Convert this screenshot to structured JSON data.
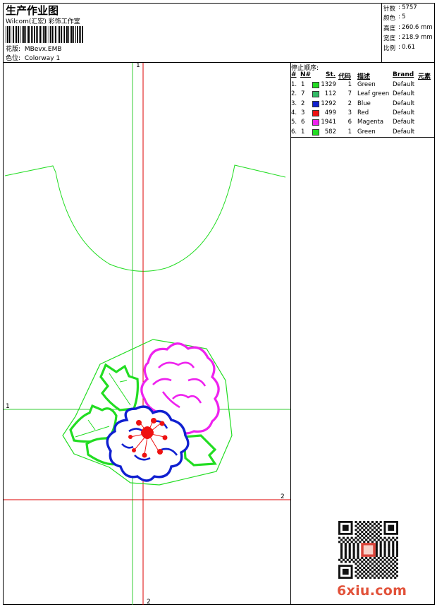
{
  "header": {
    "title": "生产作业图",
    "subtitle": "Wilcom(汇宏) 彩饰工作室",
    "design_label": "花版:",
    "design_value": "MBevx.EMB",
    "colorway_label": "色位:",
    "colorway_value": "Colorway 1"
  },
  "stats": [
    {
      "label": "针数",
      "value": "5757"
    },
    {
      "label": "颜色",
      "value": "5"
    },
    {
      "label": "高度",
      "value": "260.6 mm"
    },
    {
      "label": "宽度",
      "value": "218.9 mm"
    },
    {
      "label": "比例",
      "value": "0.61"
    }
  ],
  "sequence": {
    "title": "停止顺序:",
    "headers": {
      "index": "#",
      "no": "N#",
      "st": "St.",
      "code": "代码",
      "desc": "描述",
      "brand": "Brand",
      "elem": "元素"
    },
    "rows": [
      {
        "index": "1.",
        "no": "1",
        "color": "#22dd22",
        "st": "1329",
        "code": "1",
        "desc": "Green",
        "brand": "Default"
      },
      {
        "index": "2.",
        "no": "7",
        "color": "#33bb66",
        "st": "112",
        "code": "7",
        "desc": "Leaf green",
        "brand": "Default"
      },
      {
        "index": "3.",
        "no": "2",
        "color": "#1020d0",
        "st": "1292",
        "code": "2",
        "desc": "Blue",
        "brand": "Default"
      },
      {
        "index": "4.",
        "no": "3",
        "color": "#ee1111",
        "st": "499",
        "code": "3",
        "desc": "Red",
        "brand": "Default"
      },
      {
        "index": "5.",
        "no": "6",
        "color": "#ee22ee",
        "st": "1941",
        "code": "6",
        "desc": "Magenta",
        "brand": "Default"
      },
      {
        "index": "6.",
        "no": "1",
        "color": "#22dd22",
        "st": "582",
        "code": "1",
        "desc": "Green",
        "brand": "Default"
      }
    ]
  },
  "guides": {
    "v_green_label": "1",
    "h_green_label": "1",
    "h_red_label": "2",
    "v_red_label": "2"
  },
  "colors": {
    "green": "#22dd22",
    "blue": "#1020d0",
    "red": "#ee1111",
    "magenta": "#ee22ee",
    "guide_green": "#33cc33",
    "guide_red": "#dd0000"
  },
  "watermark": {
    "text": "6xiu.com",
    "stamp": "6xiu"
  }
}
